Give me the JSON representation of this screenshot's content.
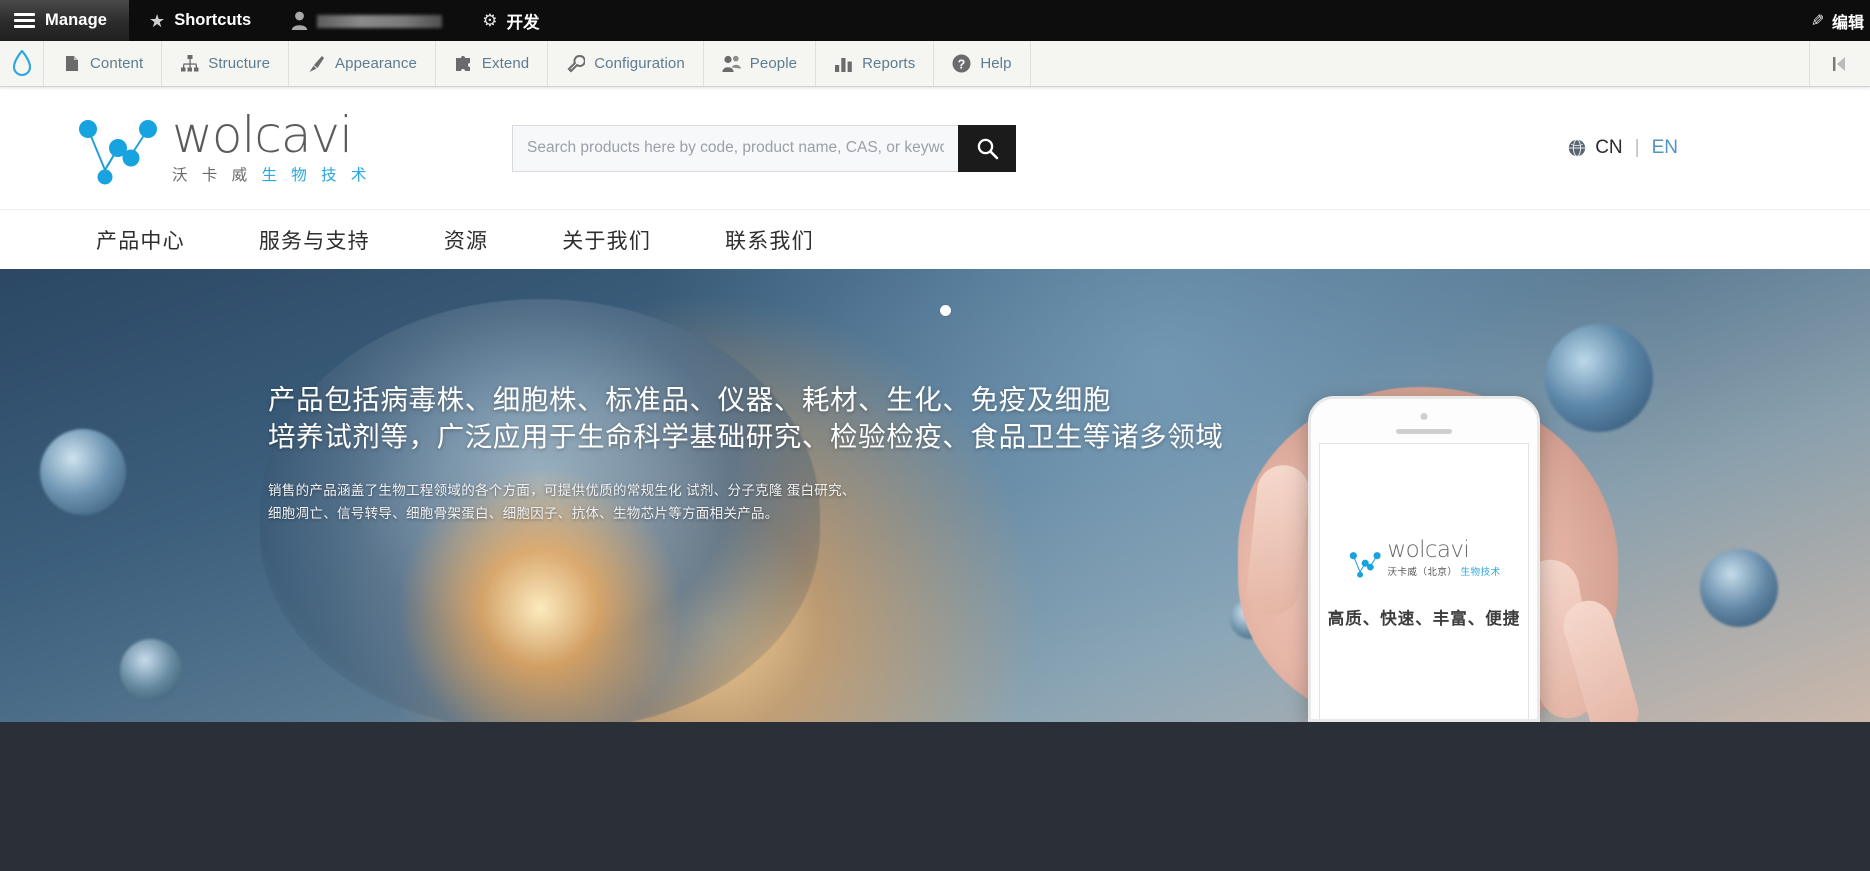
{
  "admin_bar": {
    "manage_label": "Manage",
    "manage_icon": "hamburger-menu-icon",
    "shortcuts_label": "Shortcuts",
    "shortcuts_icon": "star-icon",
    "user_icon": "user-avatar-icon",
    "user_name": "",
    "dev_label": "开发",
    "dev_icon": "gear-icon",
    "edit_label": "编辑",
    "edit_icon": "pencil-icon"
  },
  "admin_tabs": {
    "drupal_icon": "drupal-drop-icon",
    "items": [
      {
        "label": "Content",
        "icon": "file-icon"
      },
      {
        "label": "Structure",
        "icon": "structure-icon"
      },
      {
        "label": "Appearance",
        "icon": "paintbrush-icon"
      },
      {
        "label": "Extend",
        "icon": "puzzle-piece-icon"
      },
      {
        "label": "Configuration",
        "icon": "wrench-icon"
      },
      {
        "label": "People",
        "icon": "people-icon"
      },
      {
        "label": "Reports",
        "icon": "bar-chart-icon"
      },
      {
        "label": "Help",
        "icon": "question-mark-icon"
      }
    ],
    "end_icon": "collapse-icon"
  },
  "site_header": {
    "logo": {
      "icon": "wolcavi-network-logo-icon",
      "wordmark": "wolcavi",
      "sub_gray": "沃 卡 威",
      "sub_blue": "生 物 技 术"
    },
    "search": {
      "placeholder": "Search products here by code, product name, CAS, or keyword",
      "value": "",
      "button_icon": "search-icon"
    },
    "language": {
      "icon": "globe-icon",
      "active": "CN",
      "separator": "|",
      "alternate": "EN"
    }
  },
  "site_nav": {
    "items": [
      {
        "label": "产品中心"
      },
      {
        "label": "服务与支持"
      },
      {
        "label": "资源"
      },
      {
        "label": "关于我们"
      },
      {
        "label": "联系我们"
      }
    ]
  },
  "hero": {
    "slide_indicator": "slide-dot",
    "title_line1": "产品包括病毒株、细胞株、标准品、仪器、耗材、生化、免疫及细胞",
    "title_line2": "培养试剂等，广泛应用于生命科学基础研究、检验检疫、食品卫生等诸多领域",
    "sub_line1": "销售的产品涵盖了生物工程领域的各个方面，可提供优质的常规生化 试剂、分子克隆 蛋白研究、",
    "sub_line2": "细胞凋亡、信号转导、细胞骨架蛋白、细胞因子、抗体、生物芯片等方面相关产品。",
    "phone": {
      "logo_icon": "wolcavi-network-logo-icon",
      "wordmark": "wolcavi",
      "sub_gray": "沃卡威（北京）",
      "sub_blue": "生物技术",
      "slogan": "高质、快速、丰富、便捷"
    }
  },
  "colors": {
    "brand_blue": "#29a8e0",
    "admin_bar_bg": "#0d0d0d",
    "admin_tab_text": "#5d7c92",
    "logo_gray": "#5b5b5b"
  }
}
